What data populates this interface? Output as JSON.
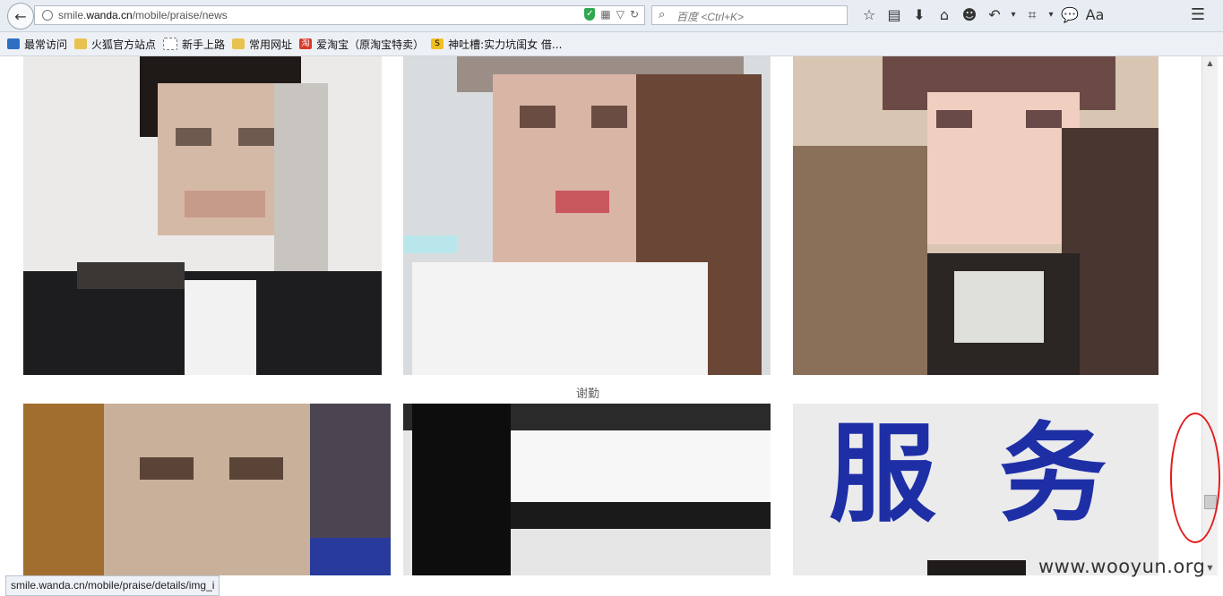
{
  "browser": {
    "url_prefix": "smile.",
    "url_host": "wanda.cn",
    "url_path": "/mobile/praise/news",
    "search_placeholder": "百度 <Ctrl+K>"
  },
  "bookmarks": [
    {
      "label": "最常访问",
      "icon": "blue"
    },
    {
      "label": "火狐官方站点",
      "icon": "folder"
    },
    {
      "label": "新手上路",
      "icon": "page"
    },
    {
      "label": "常用网址",
      "icon": "folder"
    },
    {
      "label": "爱淘宝（原淘宝特卖）",
      "icon": "red",
      "glyph": "淘"
    },
    {
      "label": "神吐槽:实力坑闺女 借...",
      "icon": "yellow",
      "glyph": "S"
    }
  ],
  "page": {
    "caption": "谢勤",
    "banner_glyphs": [
      "服",
      "务"
    ]
  },
  "status_url": "smile.wanda.cn/mobile/praise/details/img_i",
  "watermark": "www.wooyun.org",
  "colors": {
    "annotation": "#e21b1b",
    "banner_blue": "#1e2fa6"
  }
}
